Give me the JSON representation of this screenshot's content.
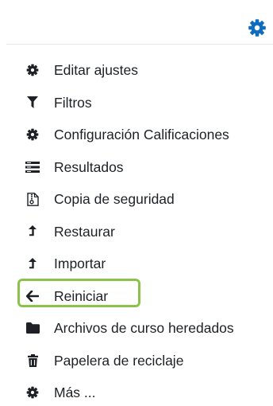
{
  "header": {
    "settings_icon": "gear-icon",
    "accent_color": "#0f6cbf"
  },
  "menu": {
    "items": [
      {
        "label": "Editar ajustes",
        "icon": "gear-icon"
      },
      {
        "label": "Filtros",
        "icon": "filter-icon"
      },
      {
        "label": "Configuración Calificaciones",
        "icon": "gear-icon"
      },
      {
        "label": "Resultados",
        "icon": "list-icon"
      },
      {
        "label": "Copia de seguridad",
        "icon": "file-archive-icon"
      },
      {
        "label": "Restaurar",
        "icon": "level-up-icon"
      },
      {
        "label": "Importar",
        "icon": "level-up-icon"
      },
      {
        "label": "Reiniciar",
        "icon": "arrow-left-icon"
      },
      {
        "label": "Archivos de curso heredados",
        "icon": "folder-icon"
      },
      {
        "label": "Papelera de reciclaje",
        "icon": "trash-icon"
      },
      {
        "label": "Más ...",
        "icon": "gear-icon"
      }
    ],
    "highlighted_item": "Reiniciar",
    "highlight_color": "#8bc34a"
  }
}
